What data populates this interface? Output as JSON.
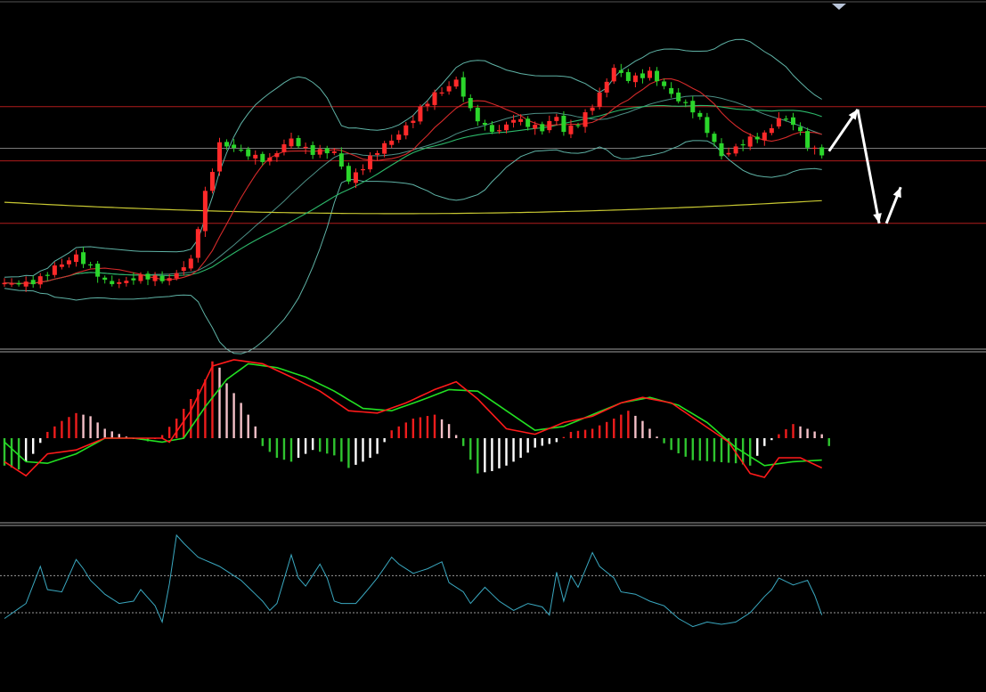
{
  "colors": {
    "background": "#000000",
    "up": "#ff2a2a",
    "down": "#2bd62b",
    "boll": "#5fb3a6",
    "ma_red": "#d42a2a",
    "ma_green": "#2cb86a",
    "ma_yellow": "#c8c832",
    "level_red": "#b01c1c",
    "level_grey": "#7a7a7a",
    "panel_divider": "#a0a0a0",
    "dif": "#ff1a1a",
    "dea": "#22e022",
    "hist_pos_strong": "#ee1c1c",
    "hist_pos_weak": "#f4c0c8",
    "hist_neg_strong": "#2fc42f",
    "hist_neg_weak": "#ffffff",
    "osc": "#3aa8c0",
    "osc_ref": "#9a9a9a",
    "arrow": "#ffffff"
  },
  "chart_data": [
    {
      "type": "candlestick",
      "panel": "price",
      "ylim": [
        70,
        250
      ],
      "x_count": 115,
      "keypoints": [
        [
          0,
          95
        ],
        [
          5,
          100
        ],
        [
          10,
          118
        ],
        [
          14,
          97
        ],
        [
          18,
          100
        ],
        [
          23,
          101
        ],
        [
          26,
          112
        ],
        [
          28,
          162
        ],
        [
          30,
          198
        ],
        [
          33,
          191
        ],
        [
          37,
          186
        ],
        [
          40,
          200
        ],
        [
          43,
          192
        ],
        [
          46,
          190
        ],
        [
          48,
          172
        ],
        [
          50,
          181
        ],
        [
          53,
          196
        ],
        [
          57,
          215
        ],
        [
          60,
          233
        ],
        [
          63,
          243
        ],
        [
          65,
          220
        ],
        [
          67,
          210
        ],
        [
          69,
          207
        ],
        [
          71,
          214
        ],
        [
          75,
          209
        ],
        [
          77,
          216
        ],
        [
          78,
          205
        ],
        [
          80,
          213
        ],
        [
          83,
          232
        ],
        [
          85,
          251
        ],
        [
          87,
          245
        ],
        [
          90,
          247
        ],
        [
          92,
          238
        ],
        [
          94,
          230
        ],
        [
          96,
          221
        ],
        [
          98,
          206
        ],
        [
          100,
          190
        ],
        [
          102,
          194
        ],
        [
          106,
          205
        ],
        [
          108,
          216
        ],
        [
          110,
          211
        ],
        [
          112,
          197
        ],
        [
          114,
          191
        ]
      ],
      "levels": [
        {
          "value": 224,
          "color": "red"
        },
        {
          "value": 194,
          "color": "grey"
        },
        {
          "value": 185,
          "color": "red"
        },
        {
          "value": 140,
          "color": "red"
        }
      ],
      "overlays": [
        "bollinger-upper",
        "bollinger-middle",
        "bollinger-lower",
        "ma-short-red",
        "ma-mid-green",
        "ma-long-yellow"
      ],
      "projection_arrows": [
        {
          "from_index": 115,
          "from_value": 192,
          "to_index": 119,
          "to_value": 222
        },
        {
          "from_index": 119,
          "from_value": 222,
          "to_index": 122,
          "to_value": 140
        },
        {
          "from_index": 123,
          "from_value": 140,
          "to_index": 125,
          "to_value": 166
        }
      ]
    },
    {
      "type": "macd",
      "panel": "macd",
      "ylim": [
        -1,
        1
      ],
      "dif_keypoints": [
        [
          0,
          -0.3
        ],
        [
          3,
          -0.48
        ],
        [
          6,
          -0.2
        ],
        [
          10,
          -0.15
        ],
        [
          14,
          0.0
        ],
        [
          18,
          0.0
        ],
        [
          22,
          0.0
        ],
        [
          23,
          -0.05
        ],
        [
          26,
          0.35
        ],
        [
          29,
          0.92
        ],
        [
          32,
          1.0
        ],
        [
          36,
          0.95
        ],
        [
          40,
          0.78
        ],
        [
          44,
          0.6
        ],
        [
          48,
          0.35
        ],
        [
          52,
          0.32
        ],
        [
          56,
          0.45
        ],
        [
          60,
          0.62
        ],
        [
          63,
          0.72
        ],
        [
          66,
          0.5
        ],
        [
          70,
          0.12
        ],
        [
          74,
          0.05
        ],
        [
          78,
          0.2
        ],
        [
          82,
          0.28
        ],
        [
          86,
          0.45
        ],
        [
          89,
          0.52
        ],
        [
          93,
          0.45
        ],
        [
          97,
          0.2
        ],
        [
          101,
          -0.05
        ],
        [
          104,
          -0.45
        ],
        [
          106,
          -0.5
        ],
        [
          108,
          -0.25
        ],
        [
          111,
          -0.25
        ],
        [
          114,
          -0.38
        ]
      ],
      "dea_keypoints": [
        [
          0,
          -0.05
        ],
        [
          3,
          -0.3
        ],
        [
          6,
          -0.32
        ],
        [
          10,
          -0.2
        ],
        [
          14,
          0.0
        ],
        [
          18,
          0.0
        ],
        [
          22,
          -0.05
        ],
        [
          25,
          0.0
        ],
        [
          28,
          0.4
        ],
        [
          31,
          0.75
        ],
        [
          34,
          0.95
        ],
        [
          38,
          0.9
        ],
        [
          42,
          0.78
        ],
        [
          46,
          0.6
        ],
        [
          50,
          0.38
        ],
        [
          54,
          0.35
        ],
        [
          58,
          0.48
        ],
        [
          62,
          0.62
        ],
        [
          66,
          0.6
        ],
        [
          70,
          0.35
        ],
        [
          74,
          0.1
        ],
        [
          78,
          0.15
        ],
        [
          82,
          0.3
        ],
        [
          86,
          0.45
        ],
        [
          90,
          0.52
        ],
        [
          94,
          0.42
        ],
        [
          98,
          0.2
        ],
        [
          102,
          -0.12
        ],
        [
          106,
          -0.35
        ],
        [
          110,
          -0.3
        ],
        [
          114,
          -0.28
        ]
      ],
      "hist_keypoints": [
        [
          0,
          -0.35
        ],
        [
          2,
          -0.4
        ],
        [
          4,
          -0.2
        ],
        [
          6,
          0.08
        ],
        [
          8,
          0.22
        ],
        [
          10,
          0.32
        ],
        [
          12,
          0.28
        ],
        [
          14,
          0.12
        ],
        [
          17,
          0.02
        ],
        [
          20,
          -0.04
        ],
        [
          22,
          0.04
        ],
        [
          24,
          0.25
        ],
        [
          26,
          0.5
        ],
        [
          28,
          0.75
        ],
        [
          29,
          0.98
        ],
        [
          30,
          0.9
        ],
        [
          31,
          0.7
        ],
        [
          33,
          0.45
        ],
        [
          35,
          0.15
        ],
        [
          36,
          -0.1
        ],
        [
          38,
          -0.25
        ],
        [
          40,
          -0.3
        ],
        [
          43,
          -0.15
        ],
        [
          46,
          -0.22
        ],
        [
          48,
          -0.38
        ],
        [
          50,
          -0.3
        ],
        [
          52,
          -0.2
        ],
        [
          54,
          0.1
        ],
        [
          57,
          0.25
        ],
        [
          60,
          0.3
        ],
        [
          62,
          0.18
        ],
        [
          64,
          -0.1
        ],
        [
          66,
          -0.45
        ],
        [
          68,
          -0.42
        ],
        [
          70,
          -0.35
        ],
        [
          72,
          -0.25
        ],
        [
          74,
          -0.12
        ],
        [
          77,
          -0.05
        ],
        [
          79,
          0.08
        ],
        [
          82,
          0.12
        ],
        [
          85,
          0.25
        ],
        [
          87,
          0.35
        ],
        [
          89,
          0.22
        ],
        [
          91,
          0.02
        ],
        [
          93,
          -0.15
        ],
        [
          96,
          -0.28
        ],
        [
          99,
          -0.3
        ],
        [
          102,
          -0.32
        ],
        [
          104,
          -0.35
        ],
        [
          106,
          -0.1
        ],
        [
          108,
          0.05
        ],
        [
          110,
          0.18
        ],
        [
          112,
          0.12
        ],
        [
          114,
          0.05
        ],
        [
          115,
          -0.1
        ]
      ]
    },
    {
      "type": "line",
      "panel": "oscillator",
      "ylim": [
        0,
        100
      ],
      "reference_lines": [
        62,
        30
      ],
      "keypoints": [
        [
          0,
          25
        ],
        [
          3,
          38
        ],
        [
          5,
          70
        ],
        [
          6,
          50
        ],
        [
          8,
          48
        ],
        [
          10,
          76
        ],
        [
          11,
          68
        ],
        [
          12,
          58
        ],
        [
          14,
          46
        ],
        [
          16,
          38
        ],
        [
          18,
          40
        ],
        [
          19,
          50
        ],
        [
          21,
          36
        ],
        [
          22,
          22
        ],
        [
          23,
          55
        ],
        [
          24,
          97
        ],
        [
          25,
          90
        ],
        [
          27,
          78
        ],
        [
          30,
          70
        ],
        [
          33,
          58
        ],
        [
          36,
          40
        ],
        [
          37,
          32
        ],
        [
          38,
          38
        ],
        [
          40,
          80
        ],
        [
          41,
          60
        ],
        [
          42,
          53
        ],
        [
          44,
          72
        ],
        [
          45,
          60
        ],
        [
          46,
          40
        ],
        [
          47,
          38
        ],
        [
          49,
          38
        ],
        [
          50,
          45
        ],
        [
          52,
          60
        ],
        [
          54,
          78
        ],
        [
          55,
          72
        ],
        [
          57,
          64
        ],
        [
          59,
          68
        ],
        [
          61,
          74
        ],
        [
          62,
          56
        ],
        [
          64,
          48
        ],
        [
          65,
          38
        ],
        [
          67,
          52
        ],
        [
          69,
          40
        ],
        [
          71,
          32
        ],
        [
          73,
          38
        ],
        [
          75,
          35
        ],
        [
          76,
          28
        ],
        [
          77,
          65
        ],
        [
          78,
          40
        ],
        [
          79,
          62
        ],
        [
          80,
          52
        ],
        [
          82,
          82
        ],
        [
          83,
          70
        ],
        [
          85,
          60
        ],
        [
          86,
          48
        ],
        [
          88,
          46
        ],
        [
          90,
          40
        ],
        [
          92,
          36
        ],
        [
          94,
          25
        ],
        [
          96,
          18
        ],
        [
          98,
          22
        ],
        [
          100,
          20
        ],
        [
          102,
          22
        ],
        [
          104,
          30
        ],
        [
          106,
          44
        ],
        [
          107,
          50
        ],
        [
          108,
          60
        ],
        [
          110,
          54
        ],
        [
          112,
          58
        ],
        [
          113,
          45
        ],
        [
          114,
          28
        ]
      ]
    }
  ]
}
